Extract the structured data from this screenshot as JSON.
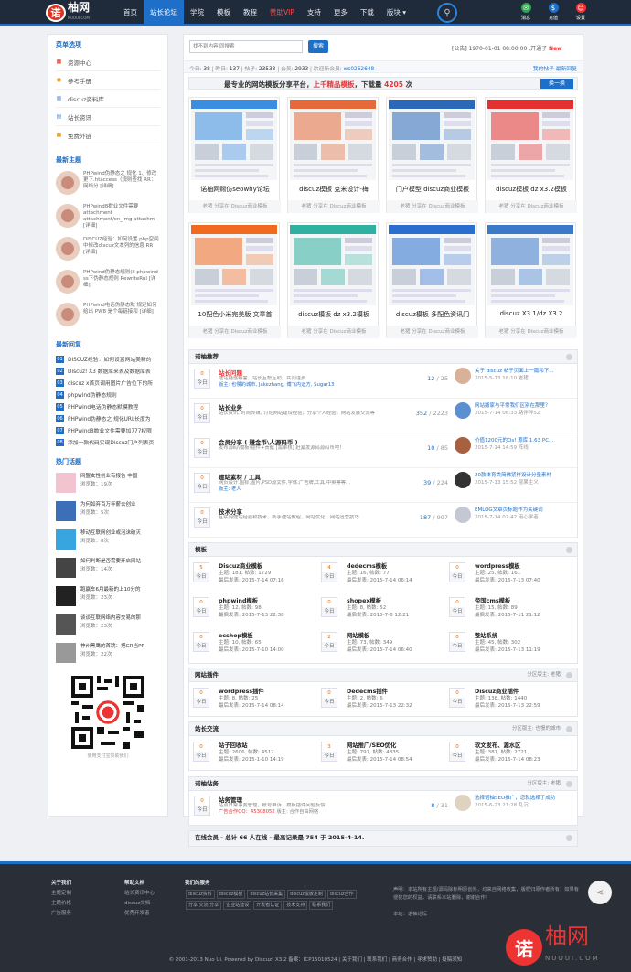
{
  "header": {
    "logo_mark": "诺",
    "logo_text": "柚网",
    "logo_sub": "NUOUI.COM",
    "nav": [
      {
        "label": "首页",
        "active": false,
        "red": false
      },
      {
        "label": "站长论坛",
        "active": true,
        "red": false
      },
      {
        "label": "学院",
        "active": false,
        "red": false
      },
      {
        "label": "模板",
        "active": false,
        "red": false
      },
      {
        "label": "教程",
        "active": false,
        "red": false
      },
      {
        "label": "赞助VIP",
        "active": false,
        "red": true
      },
      {
        "label": "支持",
        "active": false,
        "red": false
      },
      {
        "label": "更多",
        "active": false,
        "red": false
      },
      {
        "label": "下载",
        "active": false,
        "red": false
      },
      {
        "label": "版块 ▾",
        "active": false,
        "red": false
      }
    ],
    "icons": [
      {
        "label": "消息",
        "color": "#2ea44f",
        "glyph": "✉"
      },
      {
        "label": "充值",
        "color": "#1d6fc9",
        "glyph": "$"
      },
      {
        "label": "设置",
        "color": "#e33",
        "glyph": "☺"
      }
    ]
  },
  "left": {
    "menu_title": "菜单选项",
    "menu": [
      {
        "label": "资源中心",
        "color": "#e65"
      },
      {
        "label": "参考手册",
        "color": "#e9a030"
      },
      {
        "label": "discuz资料库",
        "color": "#6a9be0"
      },
      {
        "label": "站长资讯",
        "color": "#4a8fd6"
      },
      {
        "label": "免费外链",
        "color": "#e9a030"
      }
    ],
    "latest_title": "最新主题",
    "latest": [
      {
        "title": "PHPwind伪静态之 规化 1、修改更下.htaccess（规则查找 RR：网络分 [详细]"
      },
      {
        "title": "PHPwind8歇业文件需要 attachment attachment/cn_img attachm [详细]"
      },
      {
        "title": "DISCUZ经验：如何设置 php空间中修改discuz文本列的信息 RR [详细]"
      },
      {
        "title": "PHPwind伪静态规则(II phpwind ss下伪静态规则 RewriteRul [详细]"
      },
      {
        "title": "PHPwind电话伪静态默 规定如何给出 PW8 是个每链接和 [详细]"
      }
    ],
    "reply_title": "最新回复",
    "replies": [
      {
        "n": "01",
        "text": "DISCUZ经验：如何设置网站美新的"
      },
      {
        "n": "02",
        "text": "Discuz! X3 数据库来表及数据库表"
      },
      {
        "n": "03",
        "text": "discuz x首页调用图片广告位下的所"
      },
      {
        "n": "04",
        "text": "phpwind伪静态规则"
      },
      {
        "n": "05",
        "text": "PHPwind电话伪静态默模教程"
      },
      {
        "n": "06",
        "text": "PHPwind伪静态之 规化URL长度为"
      },
      {
        "n": "07",
        "text": "PHPwind8歇业文件需要加777权限"
      },
      {
        "n": "08",
        "text": "添加一款代码实现Discuz门户列表页"
      }
    ],
    "hot_title": "热门话题",
    "hot": [
      {
        "title": "网盟女性创业有报告 中国",
        "views": "浏览数：19次",
        "color": "#f2c4cf"
      },
      {
        "title": "为何如弃百万年薪去创业",
        "views": "浏览数：5次",
        "color": "#3b6fb8"
      },
      {
        "title": "移动互联网创业或泡沫破灭",
        "views": "浏览数：8次",
        "color": "#37a5e0"
      },
      {
        "title": "如何判断是否需要开启网站",
        "views": "浏览数：14次",
        "color": "#444"
      },
      {
        "title": "跑赢车6月最新的上10分的",
        "views": "浏览数：23次",
        "color": "#222"
      },
      {
        "title": "谈谈互联网络内容交易的那",
        "views": "浏览数：23次",
        "color": "#555"
      },
      {
        "title": "神州黑鹰的首跳：把GR当PR",
        "views": "浏览数：22次",
        "color": "#999"
      }
    ],
    "qr_caption": "使用支付宝赞助我们"
  },
  "main": {
    "search_placeholder": "找不到内容 同搜索",
    "search_button": "搜索",
    "notice_prefix": "[公告] 1970-01-01 08:00:00 ,开通了 ",
    "notice_new": "New",
    "stats": {
      "today_label": "今日: ",
      "today": "38",
      "yesterday_label": " | 昨日: ",
      "yesterday": "137",
      "posts_label": " | 帖子: ",
      "posts": "23533",
      "members_label": " | 会员: ",
      "members": "2933",
      "welcome_label": " | 欢迎新会员: ",
      "welcome": "ws0262648",
      "links": "我的帖子   最新回复"
    },
    "banner": {
      "a": "最专业的网站模板分享平台，",
      "b": "上千精品模板",
      "c": "，下载量 ",
      "n": "4205",
      "d": " 次",
      "button": "换一换"
    },
    "cards": [
      {
        "title": "诺柚网赐仿seowhy论坛",
        "sub": "老猪 分享在 Discuz商业模板",
        "theme": "#3b8de0"
      },
      {
        "title": "discuz模板 克米设计-梅",
        "sub": "老猪 分享在 Discuz商业模板",
        "theme": "#e46a3c"
      },
      {
        "title": "门户模型 discuz商业模板",
        "sub": "老猪 分享在 Discuz商业模板",
        "theme": "#2b68b8"
      },
      {
        "title": "discuz模板 dz x3.2模板",
        "sub": "老猪 分享在 Discuz商业模板",
        "theme": "#e33030"
      },
      {
        "title": "10配色小米完美版 文章首",
        "sub": "老猪 分享在 Discuz商业模板",
        "theme": "#f06a20"
      },
      {
        "title": "discuz模板 dz x3.2模板",
        "sub": "老猪 分享在 Discuz商业模板",
        "theme": "#2fb0a0"
      },
      {
        "title": "discuz模板 多配色资讯门",
        "sub": "老猪 分享在 Discuz商业模板",
        "theme": "#2a6fd0"
      },
      {
        "title": "discuz X3.1/dz X3.2",
        "sub": "老猪 分享在 Discuz商业模板",
        "theme": "#3a7ac8"
      }
    ],
    "recommend": {
      "title": "诺柚推荐",
      "rows": [
        {
          "z": "0",
          "name": "站长问题",
          "red": true,
          "desc": "建站疑惑解答，站长互帮互助，共同进步",
          "mod": "版主: 也慢的城市, Jakezhang, 博飞内运方, Sugar13",
          "cnt": "12",
          "tot": "25",
          "last": "关于 discuz 帖子页面上一篇和下...",
          "time": "2015-5-13 18:10 老猪",
          "av": "#d9b098"
        },
        {
          "z": "0",
          "name": "站长业务",
          "red": false,
          "desc": "站长资讯, 时尚传媒, 讨论网站建设经验，分享个人经验，网站发展交流等",
          "mod": "",
          "cnt": "352",
          "tot": "2223",
          "last": "网站搬家与平常我们区别在那里？",
          "time": "2015-7-14 06:33 路伴伴52",
          "av": "#5b8fd0"
        },
        {
          "z": "0",
          "name": "会员分享 ( 赚金币\\人源码币 )",
          "red": false,
          "desc": "发布源码\\模板\\插件+贡献 [需审核] 赶紧发源码源码币吧！",
          "mod": "",
          "cnt": "10",
          "tot": "85",
          "last": "价值1200元的Os! 源库 1.63 PC...",
          "time": "2015-7-14 14:59 阵线",
          "av": "#a76040"
        },
        {
          "z": "0",
          "name": "建站素材 / 工具",
          "red": false,
          "desc": "网页设计,图标,图片,PSD源文件,字体,广告牌,工具,中英等等...",
          "mod": "版主: 老人",
          "cnt": "39",
          "tot": "224",
          "last": "20款体育类简佛紧样设计分量素材",
          "time": "2015-7-13 15:52 混果主义",
          "av": "#333"
        },
        {
          "z": "0",
          "name": "技术分享",
          "red": false,
          "desc": "互联网建站经验和技术，新手建站教程、网站优化、网站运营技巧",
          "mod": "",
          "cnt": "187",
          "tot": "997",
          "last": "EMLOG文章页标题作为关键词",
          "time": "2015-7-14 07:42 用心学者",
          "av": "#c4c8d2"
        }
      ]
    },
    "templates": {
      "title": "模板",
      "cells": [
        {
          "z": "5",
          "name": "Discuz商业模板",
          "topics": "主题: 181, 帖数: 1729",
          "last": "最后发表: 2015-7-14 07:16"
        },
        {
          "z": "4",
          "name": "dedecms模板",
          "topics": "主题: 16, 帖数: 77",
          "last": "最后发表: 2015-7-14 06:14"
        },
        {
          "z": "0",
          "name": "wordpress模板",
          "topics": "主题: 25, 帖数: 161",
          "last": "最后发表: 2015-7-13 07:40"
        },
        {
          "z": "0",
          "name": "phpwind模板",
          "topics": "主题: 12, 帖数: 98",
          "last": "最后发表: 2015-7-13 22:38"
        },
        {
          "z": "0",
          "name": "shopex模板",
          "topics": "主题: 8, 帖数: 52",
          "last": "最后发表: 2015-7-8 12:21"
        },
        {
          "z": "0",
          "name": "帝国cms模板",
          "topics": "主题: 15, 帖数: 89",
          "last": "最后发表: 2015-7-11 21:12"
        },
        {
          "z": "0",
          "name": "ecshop模板",
          "topics": "主题: 10, 帖数: 65",
          "last": "最后发表: 2015-7-10 14:00"
        },
        {
          "z": "2",
          "name": "网站模板",
          "topics": "主题: 73, 帖数: 349",
          "last": "最后发表: 2015-7-14 06:40"
        },
        {
          "z": "0",
          "name": "整站系统",
          "topics": "主题: 45, 帖数: 302",
          "last": "最后发表: 2015-7-13 11:19"
        }
      ]
    },
    "plugins": {
      "title": "网站插件",
      "mod": "分区版主: 老猪",
      "cells": [
        {
          "z": "0",
          "name": "wordpress插件",
          "topics": "主题: 8, 帖数: 25",
          "last": "最后发表: 2015-7-14 08:14"
        },
        {
          "z": "0",
          "name": "Dedecms插件",
          "topics": "主题: 2, 帖数: 6",
          "last": "最后发表: 2015-7-13 22:32"
        },
        {
          "z": "0",
          "name": "Discuz商业插件",
          "topics": "主题: 138, 帖数: 1440",
          "last": "最后发表: 2015-7-13 22:59"
        }
      ]
    },
    "exchange": {
      "title": "站长交流",
      "mod": "分区版主: 也慢的城市",
      "cells": [
        {
          "z": "0",
          "name": "站子回收站",
          "topics": "主题: 2606, 帖数: 4512",
          "last": "最后发表: 2015-1-10 14:19"
        },
        {
          "z": "3",
          "name": "网站推广/SEO优化",
          "topics": "主题: 797, 帖数: 4835",
          "last": "最后发表: 2015-7-14 08:54"
        },
        {
          "z": "0",
          "name": "软文发布、源水区",
          "topics": "主题: 381, 帖数: 2721",
          "last": "最后发表: 2015-7-14 08:23"
        }
      ]
    },
    "affairs": {
      "title": "诺柚站务",
      "mod": "分区版主: 老猪",
      "row": {
        "z": "0",
        "name": "站务管理",
        "desc": "站点日常事务管理，账号申诉，模板插件问题反馈",
        "desc2": "广告合作QQ：45308052 ",
        "mod": "版主: 合作自由网络",
        "cnt": "8",
        "tot": "31",
        "last": "选择诺柚SEO推广，您就选择了成功",
        "time": "2015-6-23 21:28 乱沉",
        "av": "#e0d2c0"
      }
    },
    "online": "在线会员 - 总计 66 人在线 - 最高记录是 754 于 2015-4-14."
  },
  "footer": {
    "col1_title": "关于我们",
    "col1": [
      "主题定制",
      "主题价格",
      "广告服务"
    ],
    "col2_title": "帮助文档",
    "col2": [
      "站长资讯中心",
      "discuz文档",
      "优秀开发者"
    ],
    "col3_title": "我们的服务",
    "tags": [
      "discuz资料",
      "discuz模板",
      "discuz站长采集",
      "discuz模板定制",
      "discuz合作",
      "分享 交流 分享",
      "企业站建设",
      "开发者认证",
      "技术支持",
      "联系我们"
    ],
    "decl": "声明：本站所有主题/源码除标明原创外，均来自网络收集，版权归原作者所有，如果有侵犯您的权益，请联系本站删除，谢谢合作！",
    "decl2": "本站：诺柚论坛",
    "copy": "© 2001-2013 Nuo Ui. Powered by Discuz! X3.2 备案：ICP15010524 | 关于我们 | 联系我们 | 商务合作 | 寻求赞助 | 投稿须知",
    "logo_mark": "诺",
    "logo_text": "柚网",
    "logo_sub": "NUOUI.COM"
  }
}
